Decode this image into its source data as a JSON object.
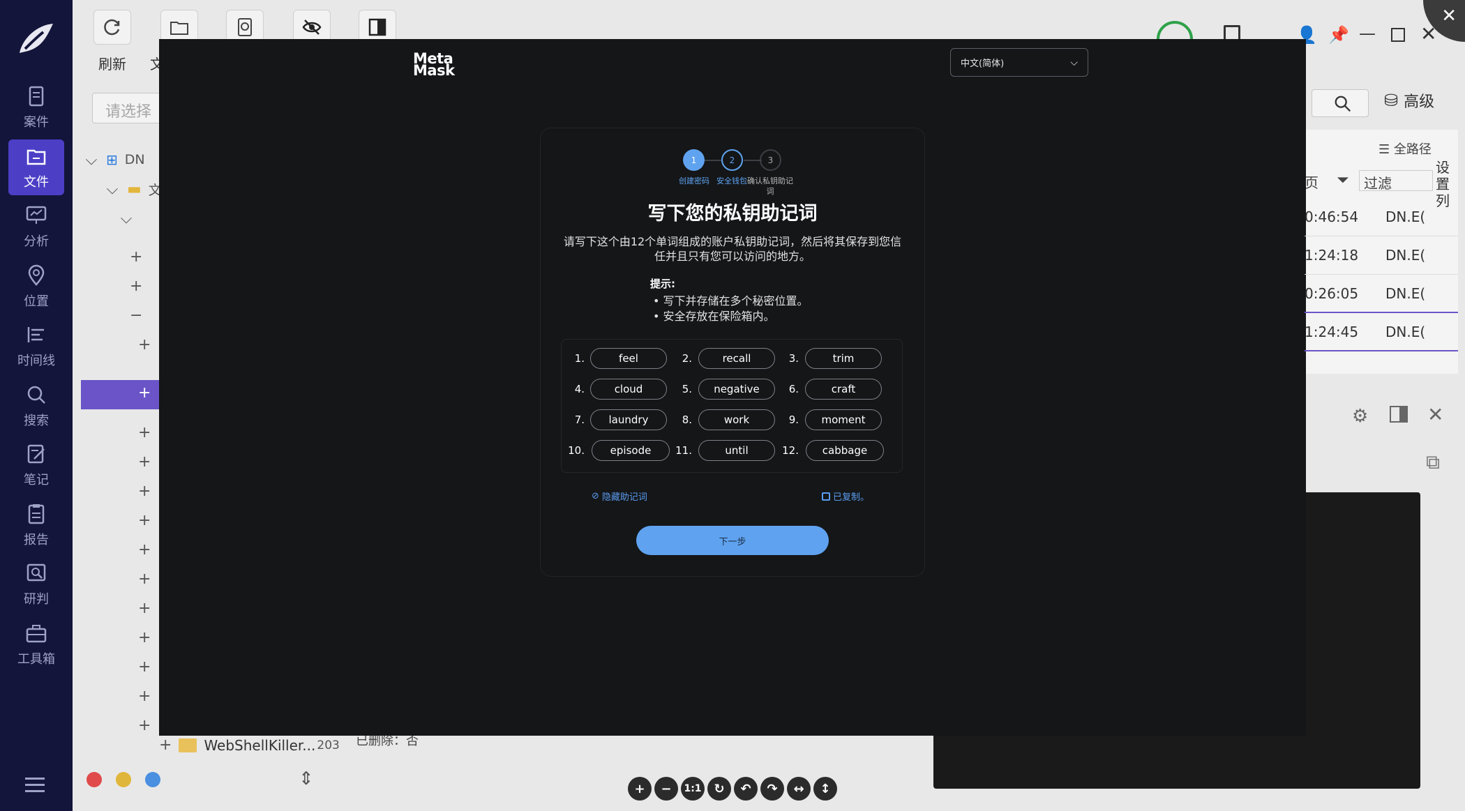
{
  "sidebar": {
    "items": [
      {
        "label": "案件",
        "icon": "case-icon"
      },
      {
        "label": "文件",
        "icon": "file-icon",
        "active": true
      },
      {
        "label": "分析",
        "icon": "analysis-icon"
      },
      {
        "label": "位置",
        "icon": "location-icon"
      },
      {
        "label": "时间线",
        "icon": "timeline-icon"
      },
      {
        "label": "搜索",
        "icon": "search-icon"
      },
      {
        "label": "笔记",
        "icon": "note-icon"
      },
      {
        "label": "报告",
        "icon": "report-icon"
      },
      {
        "label": "研判",
        "icon": "judge-icon"
      },
      {
        "label": "工具箱",
        "icon": "toolbox-icon"
      }
    ],
    "dots": [
      "#e04a4a",
      "#e0b63a",
      "#4a8fe0"
    ]
  },
  "toolbar": {
    "refresh_label": "刷新",
    "file_label": "文"
  },
  "left_panel": {
    "search_placeholder": "请选择",
    "tree_root": "DN",
    "tree_folder": "文",
    "tree_bottom_item": "WebShellKiller...",
    "tree_bottom_count": "203"
  },
  "right_panel": {
    "advanced_label": "高级",
    "full_path_label": "全路径",
    "page_label": "页",
    "filter_label": "过滤",
    "settings_columns": "设置列",
    "rows": [
      {
        "time": "0:46:54",
        "name": "DN.E("
      },
      {
        "time": "1:24:18",
        "name": "DN.E("
      },
      {
        "time": "0:26:05",
        "name": "DN.E("
      },
      {
        "time": "1:24:45",
        "name": "DN.E("
      }
    ]
  },
  "bottom": {
    "delete_label": "已删除：",
    "delete_value": "否"
  },
  "zoom_bar": [
    "+",
    "−",
    "1:1",
    "↻",
    "↶",
    "↷",
    "↔",
    "↕"
  ],
  "modal": {
    "logo_line1": "Meta",
    "logo_line2": "Mask",
    "language": "中文(简体)",
    "steps": [
      {
        "num": "1",
        "label": "创建密码",
        "state": "done"
      },
      {
        "num": "2",
        "label": "安全钱包",
        "state": "current"
      },
      {
        "num": "3",
        "label": "确认私钥助记词",
        "state": "todo"
      }
    ],
    "title": "写下您的私钥助记词",
    "description": "请写下这个由12个单词组成的账户私钥助记词，然后将其保存到您信任并且只有您可以访问的地方。",
    "tips_title": "提示:",
    "tips": [
      "写下并存储在多个秘密位置。",
      "安全存放在保险箱内。"
    ],
    "words": [
      "feel",
      "recall",
      "trim",
      "cloud",
      "negative",
      "craft",
      "laundry",
      "work",
      "moment",
      "episode",
      "until",
      "cabbage"
    ],
    "hide_label": "隐藏助记词",
    "copied_label": "已复制。",
    "next_label": "下一步",
    "accent": "#5fa3f0"
  }
}
